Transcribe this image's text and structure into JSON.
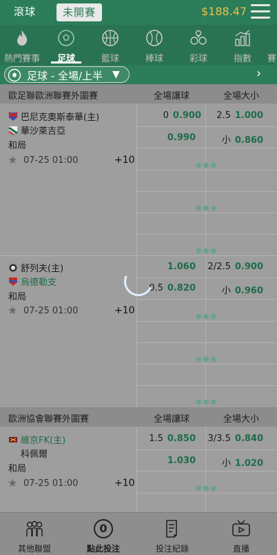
{
  "header": {
    "tab_live": "滾球",
    "tab_upcoming": "未開賽",
    "balance": "$188.47"
  },
  "sports": [
    {
      "label": "熱門賽事",
      "icon": "hot-flame-icon"
    },
    {
      "label": "足球",
      "icon": "soccer-ball-icon",
      "active": true
    },
    {
      "label": "籃球",
      "icon": "basketball-icon"
    },
    {
      "label": "棒球",
      "icon": "baseball-icon"
    },
    {
      "label": "彩球",
      "icon": "lottery-balls-icon"
    },
    {
      "label": "指數",
      "icon": "index-chart-icon"
    },
    {
      "label": "賽"
    }
  ],
  "filter": {
    "label": "足球 - 全場/上半",
    "caret": "▼",
    "next": "›"
  },
  "leagues": [
    {
      "name": "歐足聯歐洲聯賽外圍賽",
      "col_handicap": "全場讓球",
      "col_ou": "全場大小",
      "matches": [
        {
          "home": "巴尼克奧斯泰華(主)",
          "away": "華沙萊吉亞",
          "draw": "和局",
          "time": "07-25 01:00",
          "more": "+10",
          "hdp_row1_line": "0",
          "hdp_row1_price": "0.900",
          "hdp_row2_price": "0.990",
          "ou_row1_line": "2.5",
          "ou_row1_price": "1.000",
          "ou_row2_line": "小",
          "ou_row2_price": "0.860"
        },
        {
          "home": "舒列夫(主)",
          "away": "烏德勒支",
          "draw": "和局",
          "time": "07-25 01:00",
          "more": "+10",
          "hdp_row1_price": "1.060",
          "hdp_row2_line": "0.5",
          "hdp_row2_price": "0.820",
          "ou_row1_line": "2/2.5",
          "ou_row1_price": "0.900",
          "ou_row2_line": "小",
          "ou_row2_price": "0.960"
        }
      ]
    },
    {
      "name": "歐洲協會聯賽外圍賽",
      "col_handicap": "全場讓球",
      "col_ou": "全場大小",
      "matches": [
        {
          "home": "維京FK(主)",
          "away": "科佩爾",
          "draw": "和局",
          "time": "07-25 01:00",
          "more": "+10",
          "hdp_row1_line": "1.5",
          "hdp_row1_price": "0.850",
          "hdp_row2_price": "1.030",
          "ou_row1_line": "3/3.5",
          "ou_row1_price": "0.840",
          "ou_row2_line": "小",
          "ou_row2_price": "1.020"
        }
      ]
    }
  ],
  "bottom_nav": [
    {
      "label": "其他聯盟",
      "icon": "people-group-icon"
    },
    {
      "label": "點此投注",
      "icon": "bet-count-icon",
      "count": "0"
    },
    {
      "label": "投注紀錄",
      "icon": "record-document-icon"
    },
    {
      "label": "直播",
      "icon": "tv-live-icon"
    }
  ]
}
